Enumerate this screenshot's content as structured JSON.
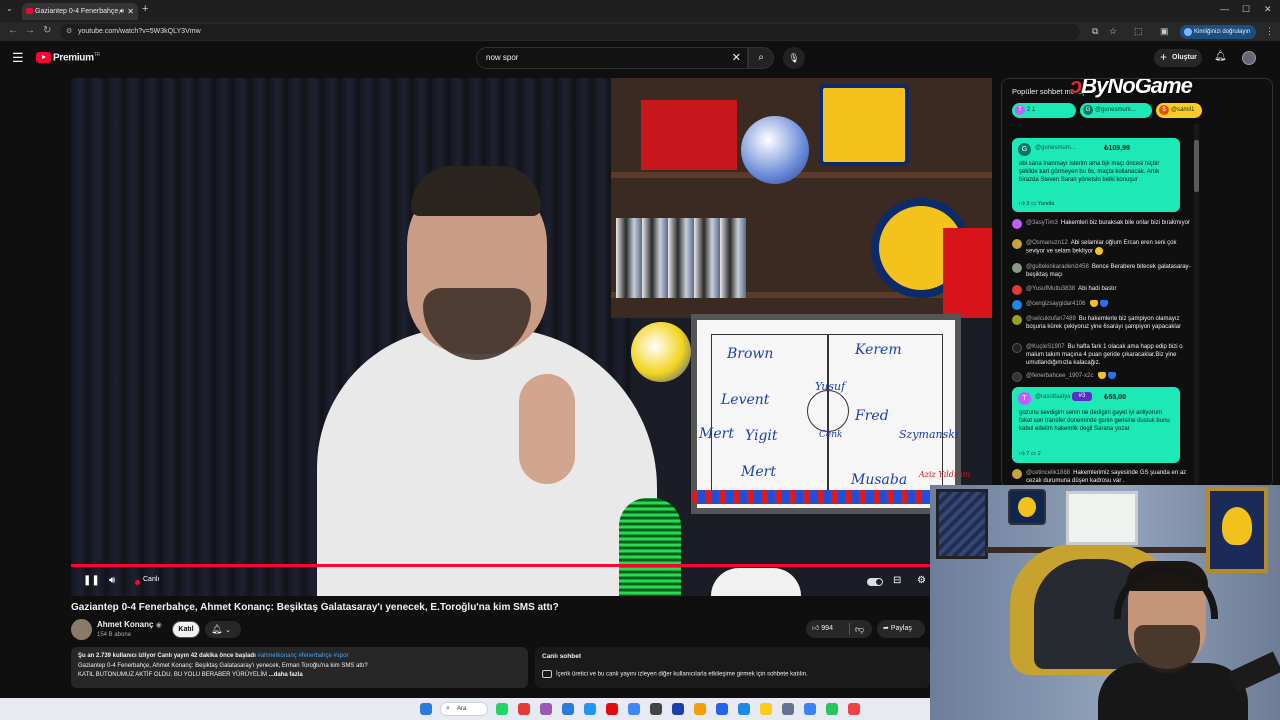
{
  "browser": {
    "tab_title": "Gaziantep 0-4 Fenerbahçe,",
    "url": "youtube.com/watch?v=5W3kQLY3Vmw",
    "profile_button": "Kimliğinizi doğrulayın"
  },
  "masthead": {
    "logo_text": "Premium",
    "logo_sup": "TR",
    "search_value": "now spor",
    "create_label": "Oluştur"
  },
  "player": {
    "live_label": "Canlı",
    "whiteboard_words": [
      "Brown",
      "Kerem",
      "Levent",
      "Yusuf",
      "Fred",
      "Szymanski",
      "Mert",
      "Yigit",
      "Mert",
      "Musaba",
      "Cenk",
      "Aziz Yıldırım"
    ]
  },
  "video": {
    "title": "Gaziantep 0-4 Fenerbahçe, Ahmet Konanç: Beşiktaş Galatasaray'ı yenecek, E.Toroğlu'na kim SMS attı?",
    "channel_name": "Ahmet Konanç",
    "verified_mark": "◉",
    "subscribers": "154 B abone",
    "join_label": "Katıl",
    "likes": "994",
    "share_label": "Paylaş"
  },
  "description": {
    "stats": "Şu an 2.739 kullanıcı izliyor  Canlı yayın 42 dakika önce başladı",
    "tags": "#ahmetkonanç #fenerbahçe #spor",
    "line2": "Gaziantep 0-4 Fenerbahçe, Ahmet Konanç: Beşiktaş Galatasaray'ı yenecek, Erman Toroğlu'na kim SMS attı?",
    "line3": "KATIL BUTONUMUZ AKTİF OLDU. BU YOLU BERABER YÜRÜYELİM",
    "more": "...daha fazla"
  },
  "live_chat_box": {
    "heading": "Canlı sohbet",
    "text": "İçerik üretici ve bu canlı yayını izleyen diğer kullanıcılarla etkileşime girmek için sohbete katılın."
  },
  "chat": {
    "title": "Popüler sohbet mesajları",
    "overlay_brand": "ByNoGame",
    "tickers": [
      {
        "initial": "T",
        "label": "2  1",
        "color": "#1de9b6"
      },
      {
        "initial": "G",
        "label": "@gunesmum...",
        "color": "#1de9b6"
      },
      {
        "initial": "$",
        "label": "@samil1",
        "color": "#ffca28"
      }
    ],
    "superchat1": {
      "initial": "G",
      "author": "@gunesmum...",
      "amount": "₺109,99",
      "message": "abi sana inanmayı isterim ama bjk maçı öncesi hiçbir şekilde kart görmeyen bu 6s, maçta kollanacak. Artık birazda Steven Saran yönetsin belki konuşur",
      "likes": "3",
      "reply": "Yanıtla"
    },
    "messages": [
      {
        "author": "@3asyTim3",
        "text": "Hakemleri biz buraksak bile onlar bizi bırakmıyor",
        "color": "#c45cff"
      },
      {
        "author": "@Osmanuzn12",
        "text": "Abi selamlar oğlum Ercan eren seni çok seviyor ve selam bekliyor",
        "color": "#c9a23a",
        "emoji": "s"
      },
      {
        "author": "@gultekinkaradeniz458",
        "text": "Bence Beraberе bitecek galatasaray-beşiktaş maçı",
        "color": "#8a9a8a"
      },
      {
        "author": "@YusufMutlu3838",
        "text": "Abi hadi bastır",
        "color": "#e53935"
      },
      {
        "author": "@cengizsaygidar4106",
        "text": "",
        "color": "#1e88e5",
        "emoji": "yb"
      },
      {
        "author": "@selcuktufan7489",
        "text": "Bu hakemlerle biz şampiyon olamayız boşuna kürek çekiyoruz yine 6sarayı şampiyon yapacaklar",
        "color": "#9e9d24"
      },
      {
        "author": "@KuçlеS1907",
        "text": "Bu hafta fark 1 olacak ama happ edip bizi o malum takım maçına 4 puan geride çıkaracaklar.Biz yine umutlandığımızla kalacağız.",
        "color": "#222222"
      },
      {
        "author": "@fenerbahcee_1907-x2c",
        "text": "",
        "color": "#333333",
        "emoji": "yb"
      }
    ],
    "superchat2": {
      "initial": "T",
      "author": "@rasottaalya",
      "badge": "#3",
      "amount": "₺55,00",
      "message": "gozunu sevdigim senin ne dedigini gayet iyi anliyorum fakat son transfer doneminde gsnin gerisine dustuk bunu kabul edelim hakemlik degil Sarana yozar",
      "likes": "7",
      "replies": "2"
    },
    "last_message": {
      "author": "@cetincelik1888",
      "text": "Hakemlerimiz sayesinde GS şuanda en az cezalı durumuna düşen kadrosu var .",
      "color": "#c9a23a"
    }
  },
  "taskbar": {
    "search_label": "Ara",
    "app_colors": [
      "#2b7bd8",
      "#25d366",
      "#e53935",
      "#9b59b6",
      "#2b7bd8",
      "#2196f3",
      "#e50914",
      "#4285f4",
      "#444444",
      "#1e40af",
      "#f59e0b",
      "#2563eb",
      "#1e88e5",
      "#facc15",
      "#64748b",
      "#3b82f6",
      "#22c55e",
      "#ef4444"
    ]
  }
}
